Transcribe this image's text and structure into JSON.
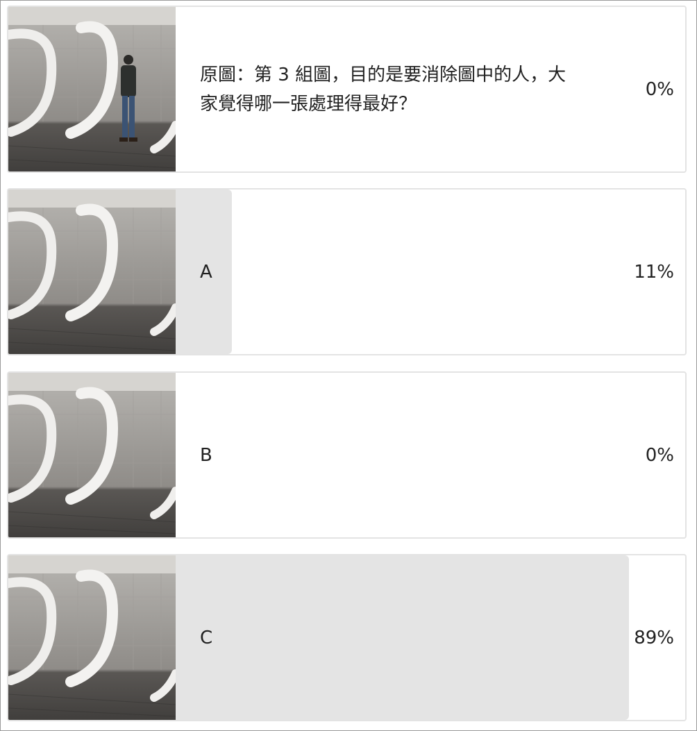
{
  "poll": {
    "options": [
      {
        "label": "原圖：第 3 組圖，目的是要消除圖中的人，大家覺得哪一張處理得最好？",
        "percent_text": "0%",
        "share": 0,
        "photo": "photo-with-person"
      },
      {
        "label": "A",
        "percent_text": "11%",
        "share": 0.11,
        "photo": "photo-person-removed"
      },
      {
        "label": "B",
        "percent_text": "0%",
        "share": 0,
        "photo": "photo-person-removed"
      },
      {
        "label": "C",
        "percent_text": "89%",
        "share": 0.89,
        "photo": "photo-person-removed"
      }
    ]
  },
  "colors": {
    "bar_fill": "#e4e4e4",
    "card_border": "#e3e3e3",
    "text": "#212121"
  }
}
